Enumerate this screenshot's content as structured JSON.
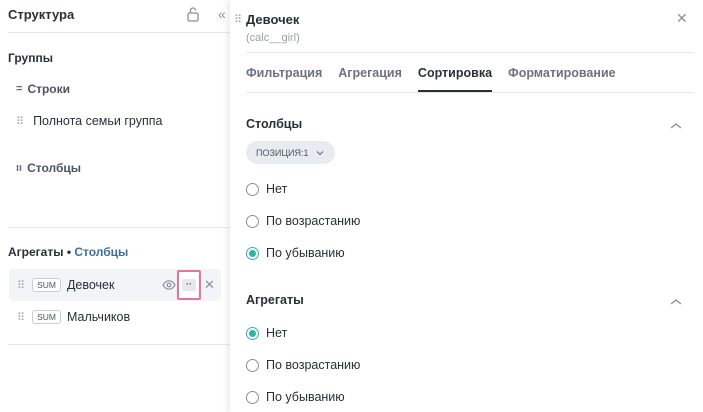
{
  "left": {
    "title": "Структура",
    "groups_label": "Группы",
    "rows_label": "Строки",
    "rows_glyph": "=",
    "row_field": "Полнота семьи группа",
    "cols_label": "Столбцы",
    "cols_glyph": "ıı",
    "aggregates_label": "Агрегаты",
    "aggregates_separator": "•",
    "aggregates_target": "Столбцы",
    "aggregates": [
      {
        "badge": "SUM",
        "name": "Девочек"
      },
      {
        "badge": "SUM",
        "name": "Мальчиков"
      }
    ]
  },
  "panel": {
    "title": "Девочек",
    "subtitle": "(calc__girl)",
    "tabs": [
      "Фильтрация",
      "Агрегация",
      "Сортировка",
      "Форматирование"
    ],
    "active_tab": "Сортировка",
    "columns_section": {
      "title": "Столбцы",
      "chip": "ПОЗИЦИЯ:1",
      "options": [
        "Нет",
        "По возрастанию",
        "По убыванию"
      ],
      "selected": "По убыванию"
    },
    "aggregates_section": {
      "title": "Агрегаты",
      "options": [
        "Нет",
        "По возрастанию",
        "По убыванию"
      ],
      "selected": "Нет"
    }
  },
  "colors": {
    "accent": "#3f6e96",
    "radio_checked": "#2fb3a6",
    "highlight": "#e7739a"
  }
}
